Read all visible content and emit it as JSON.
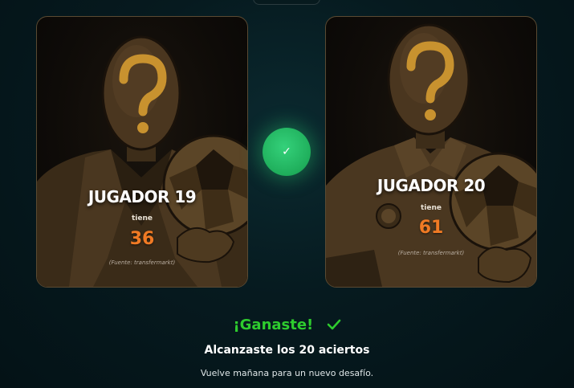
{
  "game": {
    "cards": [
      {
        "player": "JUGADOR 19",
        "has_label": "tiene",
        "value": "36",
        "source": "(Fuente: transfermarkt)"
      },
      {
        "player": "JUGADOR 20",
        "has_label": "tiene",
        "value": "61",
        "source": "(Fuente: transfermarkt)"
      }
    ],
    "center_icon": "check-icon",
    "center_glyph": "✓"
  },
  "result": {
    "title": "¡Ganaste!",
    "title_icon": "check-icon",
    "streak_text": "Alcanzaste los 20 aciertos",
    "note": "Vuelve mañana para un nuevo desafío."
  },
  "colors": {
    "accent_green": "#2ecc2e",
    "value_orange": "#f07a24",
    "card_border": "#5a4a32"
  }
}
